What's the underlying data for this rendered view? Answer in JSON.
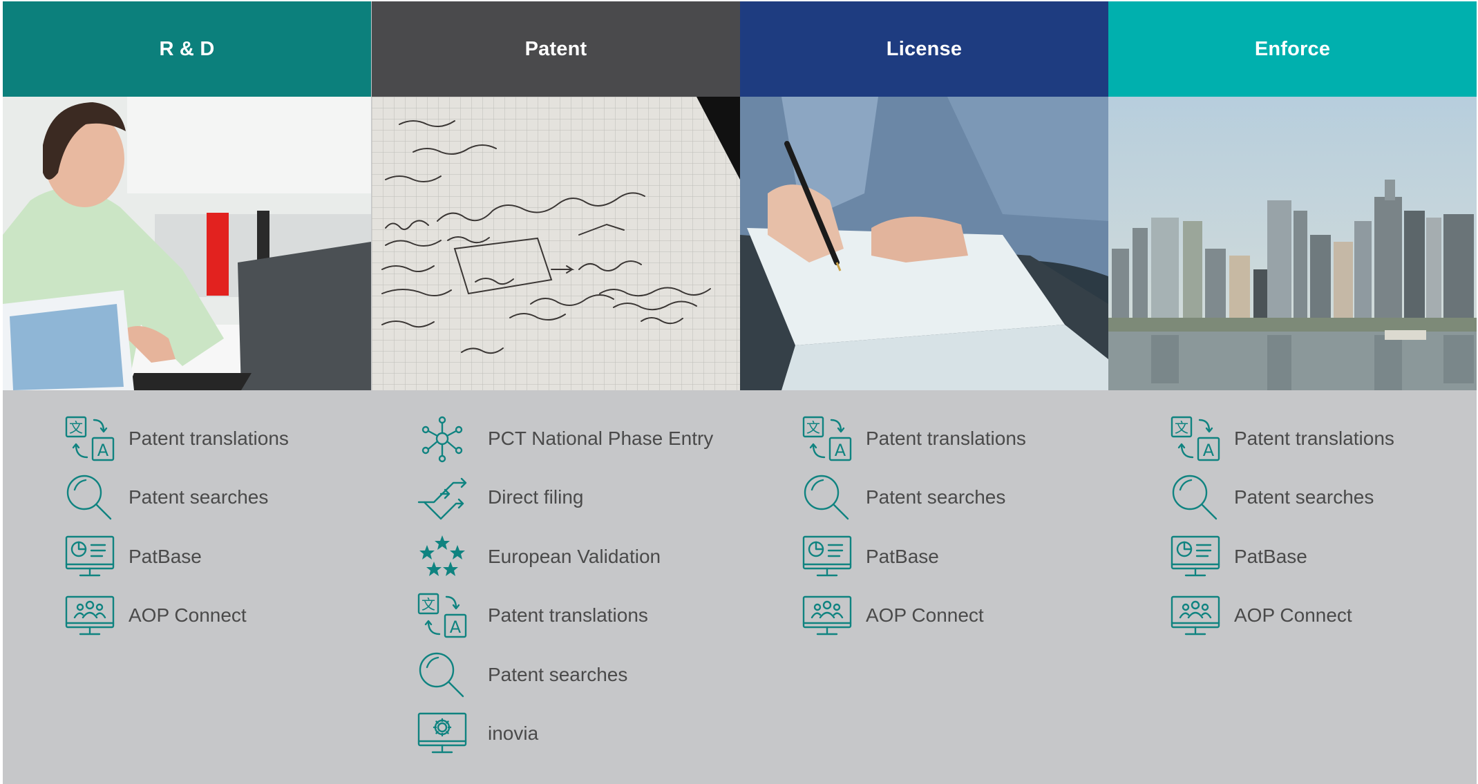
{
  "colors": {
    "rd": "#0c807c",
    "patent": "#4a4a4c",
    "license": "#1e3c80",
    "enforce": "#00b0ae",
    "icon": "#0f8380",
    "panel": "#c6c7c9",
    "text": "#4a4a4a"
  },
  "columns": [
    {
      "title": "R & D",
      "items": [
        {
          "label": "Patent translations",
          "icon": "translate-icon"
        },
        {
          "label": "Patent searches",
          "icon": "magnifier-icon"
        },
        {
          "label": "PatBase",
          "icon": "dashboard-monitor-icon"
        },
        {
          "label": "AOP Connect",
          "icon": "users-monitor-icon"
        }
      ]
    },
    {
      "title": "Patent",
      "items": [
        {
          "label": "PCT National Phase Entry",
          "icon": "network-nodes-icon"
        },
        {
          "label": "Direct filing",
          "icon": "direct-arrows-icon"
        },
        {
          "label": "European Validation",
          "icon": "eu-stars-icon"
        },
        {
          "label": "Patent translations",
          "icon": "translate-icon"
        },
        {
          "label": "Patent searches",
          "icon": "magnifier-icon"
        },
        {
          "label": "inovia",
          "icon": "gear-monitor-icon"
        }
      ]
    },
    {
      "title": "License",
      "items": [
        {
          "label": "Patent translations",
          "icon": "translate-icon"
        },
        {
          "label": "Patent searches",
          "icon": "magnifier-icon"
        },
        {
          "label": "PatBase",
          "icon": "dashboard-monitor-icon"
        },
        {
          "label": "AOP Connect",
          "icon": "users-monitor-icon"
        }
      ]
    },
    {
      "title": "Enforce",
      "items": [
        {
          "label": "Patent translations",
          "icon": "translate-icon"
        },
        {
          "label": "Patent searches",
          "icon": "magnifier-icon"
        },
        {
          "label": "PatBase",
          "icon": "dashboard-monitor-icon"
        },
        {
          "label": "AOP Connect",
          "icon": "users-monitor-icon"
        }
      ]
    }
  ]
}
